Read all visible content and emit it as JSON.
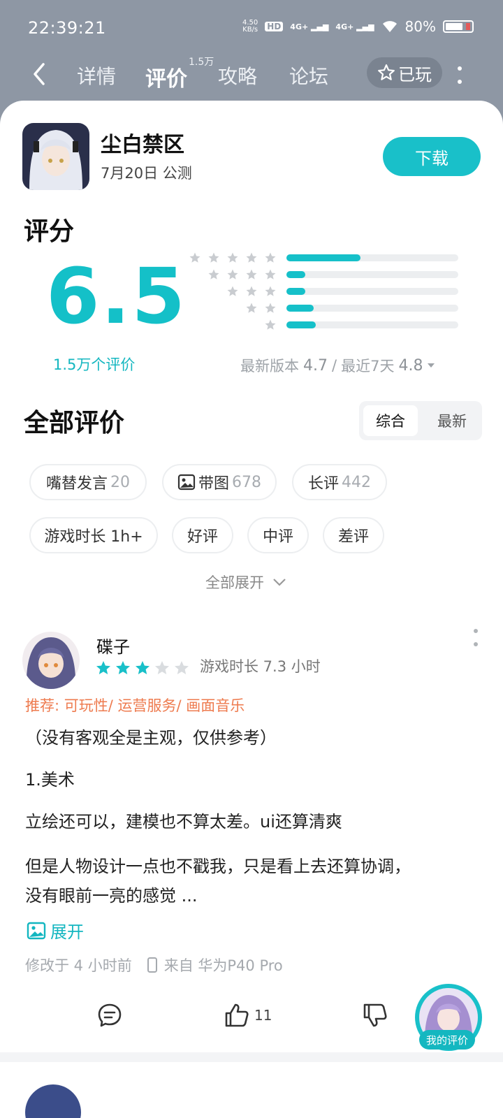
{
  "status_bar": {
    "time": "22:39:21",
    "net_speed_value": "4.50",
    "net_speed_unit": "KB/s",
    "hd": "HD",
    "sim1": "4G+",
    "sim2": "4G+",
    "battery": "80%"
  },
  "nav": {
    "tabs": [
      {
        "label": "详情"
      },
      {
        "label": "评价",
        "badge": "1.5万"
      },
      {
        "label": "攻略"
      },
      {
        "label": "论坛"
      }
    ],
    "played_label": "已玩"
  },
  "game": {
    "title": "尘白禁区",
    "subtitle": "7月20日 公测",
    "download_label": "下载"
  },
  "rating": {
    "heading": "评分",
    "score": "6.5",
    "review_count": "1.5万个评价",
    "latest_version_label": "最新版本",
    "latest_version_score": "4.7",
    "recent_label": "最近7天",
    "recent_score": "4.8",
    "distribution": [
      {
        "stars": 5,
        "fraction": 0.43
      },
      {
        "stars": 4,
        "fraction": 0.11
      },
      {
        "stars": 3,
        "fraction": 0.11
      },
      {
        "stars": 2,
        "fraction": 0.16
      },
      {
        "stars": 1,
        "fraction": 0.17
      }
    ]
  },
  "reviews_section": {
    "heading": "全部评价",
    "sort_options": [
      "综合",
      "最新"
    ],
    "sort_selected": "综合",
    "filters": [
      {
        "label": "嘴替发言",
        "count": "20"
      },
      {
        "label": "带图",
        "count": "678",
        "icon": "image-icon"
      },
      {
        "label": "长评",
        "count": "442"
      },
      {
        "label": "游戏时长 1h+"
      },
      {
        "label": "好评"
      },
      {
        "label": "中评"
      },
      {
        "label": "差评"
      }
    ],
    "expand_all_label": "全部展开"
  },
  "review": {
    "author": "碟子",
    "stars": 3,
    "max_stars": 5,
    "playtime": "游戏时长 7.3 小时",
    "recommend": "推荐: 可玩性/ 运营服务/ 画面音乐",
    "lines": [
      "（没有客观全是主观，仅供参考）",
      "1.美术",
      "立绘还可以，建模也不算太差。ui还算清爽",
      "但是人物设计一点也不戳我，只是看上去还算协调，",
      "没有眼前一亮的感觉 ..."
    ],
    "expand_label": "展开",
    "modified": "修改于 4 小时前",
    "device": "来自 华为P40 Pro",
    "likes": "11"
  },
  "my_review_label": "我的评价",
  "colors": {
    "accent": "#19c0c9",
    "recommend": "#ee7b4f",
    "header_bg": "#8e97a4"
  }
}
